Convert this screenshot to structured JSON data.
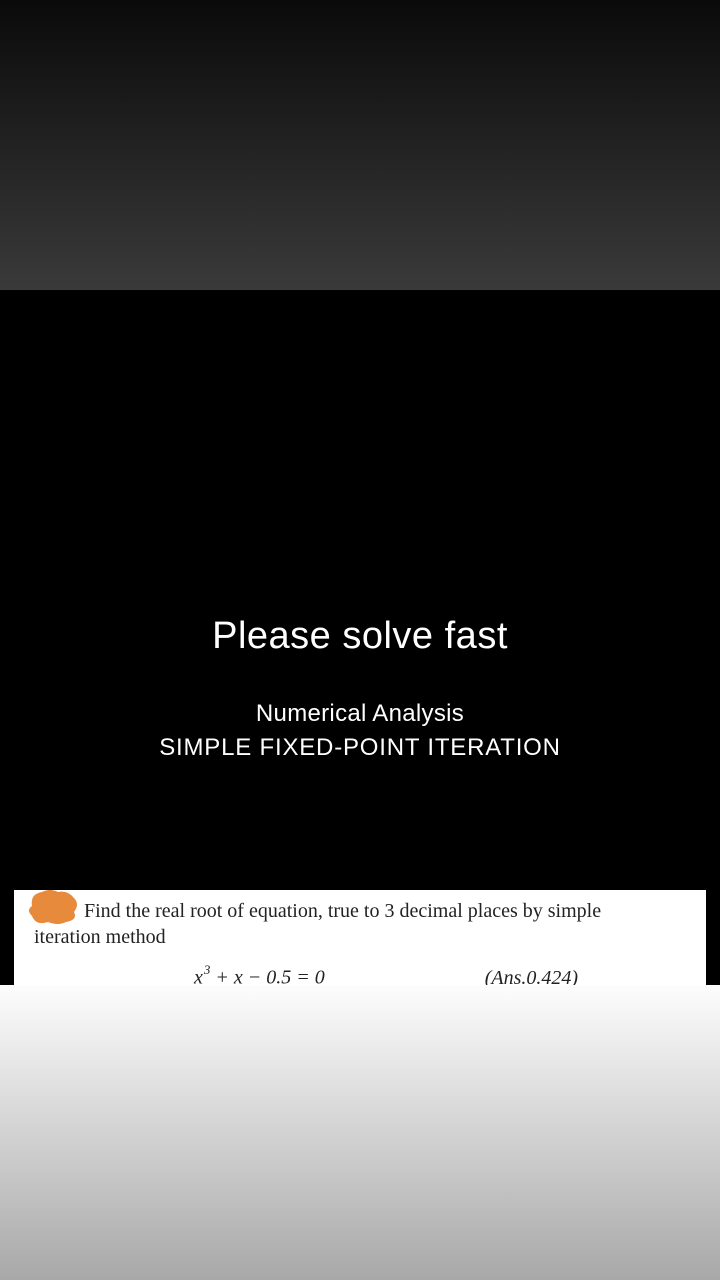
{
  "heading": {
    "main": "Please solve fast",
    "sub1": "Numerical Analysis",
    "sub2": "SIMPLE FIXED-POINT ITERATION"
  },
  "problem": {
    "line1": "Find the real root of equation, true to 3 decimal places by simple",
    "line2": "iteration method",
    "equation_var": "x",
    "equation_exp": "3",
    "equation_plus": " + x − 0.5 = 0",
    "answer": "(Ans.0.424)"
  }
}
